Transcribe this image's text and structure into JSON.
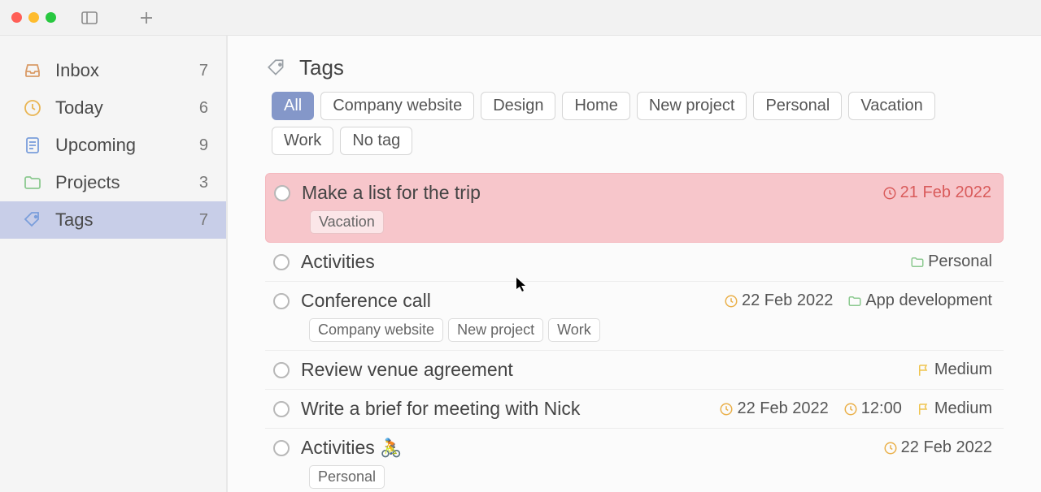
{
  "sidebar": {
    "items": [
      {
        "id": "inbox",
        "label": "Inbox",
        "count": "7"
      },
      {
        "id": "today",
        "label": "Today",
        "count": "6"
      },
      {
        "id": "upcoming",
        "label": "Upcoming",
        "count": "9"
      },
      {
        "id": "projects",
        "label": "Projects",
        "count": "3"
      },
      {
        "id": "tags",
        "label": "Tags",
        "count": "7"
      }
    ],
    "active": "tags"
  },
  "header": {
    "title": "Tags"
  },
  "tag_filters": {
    "active": "All",
    "items": [
      "All",
      "Company website",
      "Design",
      "Home",
      "New project",
      "Personal",
      "Vacation",
      "Work",
      "No tag"
    ]
  },
  "tasks": [
    {
      "id": "t1",
      "highlight": true,
      "title": "Make a list for the trip",
      "date": "21 Feb 2022",
      "date_overdue": true,
      "tags": [
        "Vacation"
      ]
    },
    {
      "id": "t2",
      "title": "Activities",
      "folder": "Personal"
    },
    {
      "id": "t3",
      "title": "Conference call",
      "date": "22 Feb 2022",
      "folder": "App development",
      "tags": [
        "Company website",
        "New project",
        "Work"
      ]
    },
    {
      "id": "t4",
      "title": "Review venue agreement",
      "priority": "Medium"
    },
    {
      "id": "t5",
      "title": "Write a brief for meeting with Nick",
      "date": "22 Feb 2022",
      "time": "12:00",
      "priority": "Medium"
    },
    {
      "id": "t6",
      "title": "Activities",
      "emoji": "🚴",
      "date": "22 Feb 2022",
      "tags": [
        "Personal"
      ]
    }
  ]
}
